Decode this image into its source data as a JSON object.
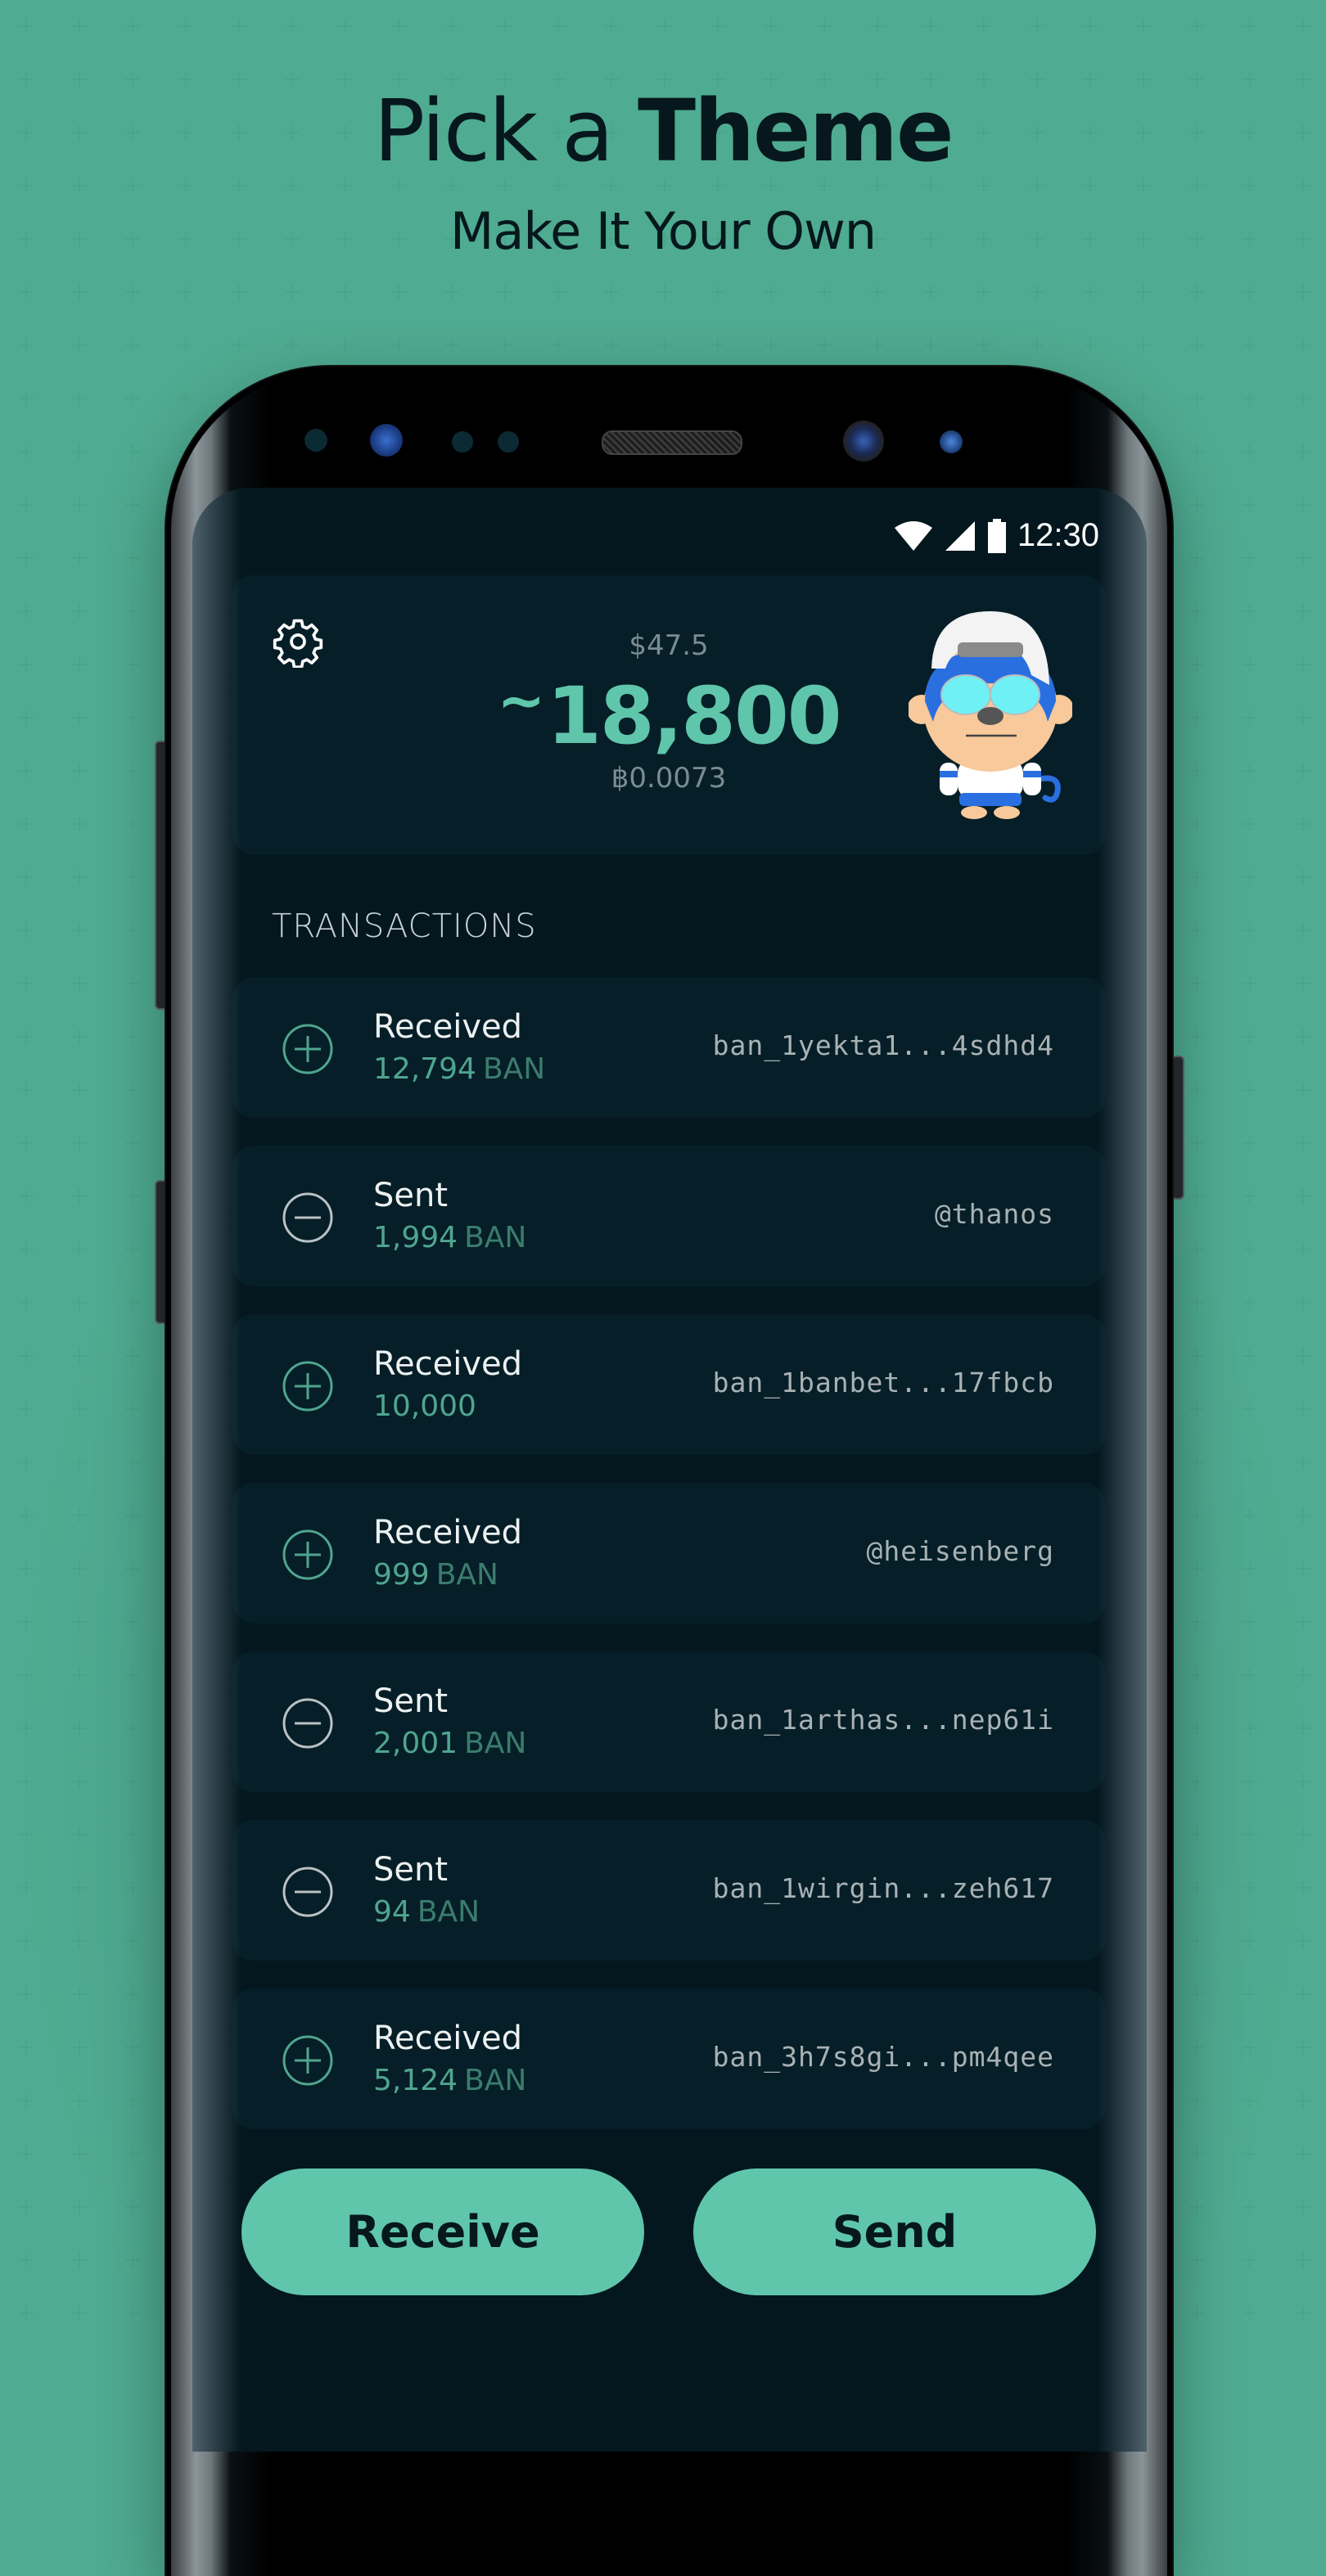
{
  "promo": {
    "headline_regular": "Pick a ",
    "headline_bold": "Theme",
    "subheadline": "Make It Your Own"
  },
  "colors": {
    "background": "#5fc6ab",
    "accent": "#5fc6ab",
    "screen_bg": "#04171f",
    "card_bg": "#061e27",
    "received_icon": "#4fa58e",
    "sent_icon": "#b9c2c4"
  },
  "status_bar": {
    "time": "12:30",
    "icons": [
      "wifi-icon",
      "signal-icon",
      "battery-icon"
    ]
  },
  "wallet": {
    "settings_icon": "gear-icon",
    "fiat_value": "$47.5",
    "currency_symbol": "~",
    "balance": "18,800",
    "btc_value": "฿0.0073",
    "avatar": "monkey-avatar"
  },
  "transactions": {
    "label": "TRANSACTIONS",
    "items": [
      {
        "type": "Received",
        "direction": "in",
        "amount": "12,794",
        "unit": "BAN",
        "address": "ban_1yekta1...4sdhd4"
      },
      {
        "type": "Sent",
        "direction": "out",
        "amount": "1,994",
        "unit": "BAN",
        "address": "@thanos"
      },
      {
        "type": "Received",
        "direction": "in",
        "amount": "10,000",
        "unit": "",
        "address": "ban_1banbet...17fbcb"
      },
      {
        "type": "Received",
        "direction": "in",
        "amount": "999",
        "unit": "BAN",
        "address": "@heisenberg"
      },
      {
        "type": "Sent",
        "direction": "out",
        "amount": "2,001",
        "unit": "BAN",
        "address": "ban_1arthas...nep61i"
      },
      {
        "type": "Sent",
        "direction": "out",
        "amount": "94",
        "unit": "BAN",
        "address": "ban_1wirgin...zeh617"
      },
      {
        "type": "Received",
        "direction": "in",
        "amount": "5,124",
        "unit": "BAN",
        "address": "ban_3h7s8gi...pm4qee"
      }
    ]
  },
  "actions": {
    "receive_label": "Receive",
    "send_label": "Send"
  }
}
